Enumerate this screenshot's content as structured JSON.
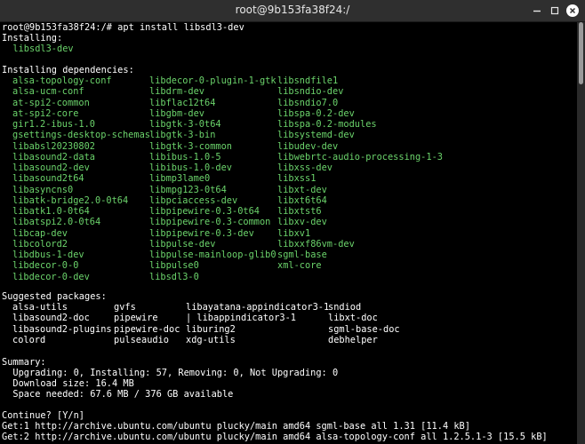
{
  "window": {
    "title": "root@9b153fa38f24:/"
  },
  "terminal": {
    "prompt_line": "root@9b153fa38f24:/# apt install libsdl3-dev",
    "installing_header": "Installing:",
    "installing_pkg": "  libsdl3-dev",
    "deps_header": "Installing dependencies:",
    "deps_rows": [
      [
        "alsa-topology-conf",
        "libdecor-0-plugin-1-gtk",
        "libsndfile1"
      ],
      [
        "alsa-ucm-conf",
        "libdrm-dev",
        "libsndio-dev"
      ],
      [
        "at-spi2-common",
        "libflac12t64",
        "libsndio7.0"
      ],
      [
        "at-spi2-core",
        "libgbm-dev",
        "libspa-0.2-dev"
      ],
      [
        "gir1.2-ibus-1.0",
        "libgtk-3-0t64",
        "libspa-0.2-modules"
      ],
      [
        "gsettings-desktop-schemas",
        "libgtk-3-bin",
        "libsystemd-dev"
      ],
      [
        "libabsl20230802",
        "libgtk-3-common",
        "libudev-dev"
      ],
      [
        "libasound2-data",
        "libibus-1.0-5",
        "libwebrtc-audio-processing-1-3"
      ],
      [
        "libasound2-dev",
        "libibus-1.0-dev",
        "libxss-dev"
      ],
      [
        "libasound2t64",
        "libmp3lame0",
        "libxss1"
      ],
      [
        "libasyncns0",
        "libmpg123-0t64",
        "libxt-dev"
      ],
      [
        "libatk-bridge2.0-0t64",
        "libpciaccess-dev",
        "libxt6t64"
      ],
      [
        "libatk1.0-0t64",
        "libpipewire-0.3-0t64",
        "libxtst6"
      ],
      [
        "libatspi2.0-0t64",
        "libpipewire-0.3-common",
        "libxv-dev"
      ],
      [
        "libcap-dev",
        "libpipewire-0.3-dev",
        "libxv1"
      ],
      [
        "libcolord2",
        "libpulse-dev",
        "libxxf86vm-dev"
      ],
      [
        "libdbus-1-dev",
        "libpulse-mainloop-glib0",
        "sgml-base"
      ],
      [
        "libdecor-0-0",
        "libpulse0",
        "xml-core"
      ],
      [
        "libdecor-0-dev",
        "libsdl3-0",
        ""
      ]
    ],
    "suggested_header": "Suggested packages:",
    "suggested_rows": [
      [
        "alsa-utils",
        "gvfs",
        "libayatana-appindicator3-1",
        "sndiod"
      ],
      [
        "libasound2-doc",
        "pipewire",
        "| libappindicator3-1",
        "libxt-doc"
      ],
      [
        "libasound2-plugins",
        "pipewire-doc",
        "liburing2",
        "sgml-base-doc"
      ],
      [
        "colord",
        "pulseaudio",
        "xdg-utils",
        "debhelper"
      ]
    ],
    "summary_header": "Summary:",
    "summary_lines": [
      "  Upgrading: 0, Installing: 57, Removing: 0, Not Upgrading: 0",
      "  Download size: 16.4 MB",
      "  Space needed: 67.6 MB / 376 GB available"
    ],
    "continue_line": "Continue? [Y/n]",
    "get_lines": [
      "Get:1 http://archive.ubuntu.com/ubuntu plucky/main amd64 sgml-base all 1.31 [11.4 kB]",
      "Get:2 http://archive.ubuntu.com/ubuntu plucky/main amd64 alsa-topology-conf all 1.2.5.1-3 [15.5 kB]"
    ]
  },
  "icons": {
    "minimize": "minimize-icon",
    "maximize": "maximize-icon",
    "close": "close-icon"
  },
  "colors": {
    "package_green": "#6bd36b",
    "terminal_bg": "#000000",
    "titlebar_bg": "#2f2f2f"
  }
}
